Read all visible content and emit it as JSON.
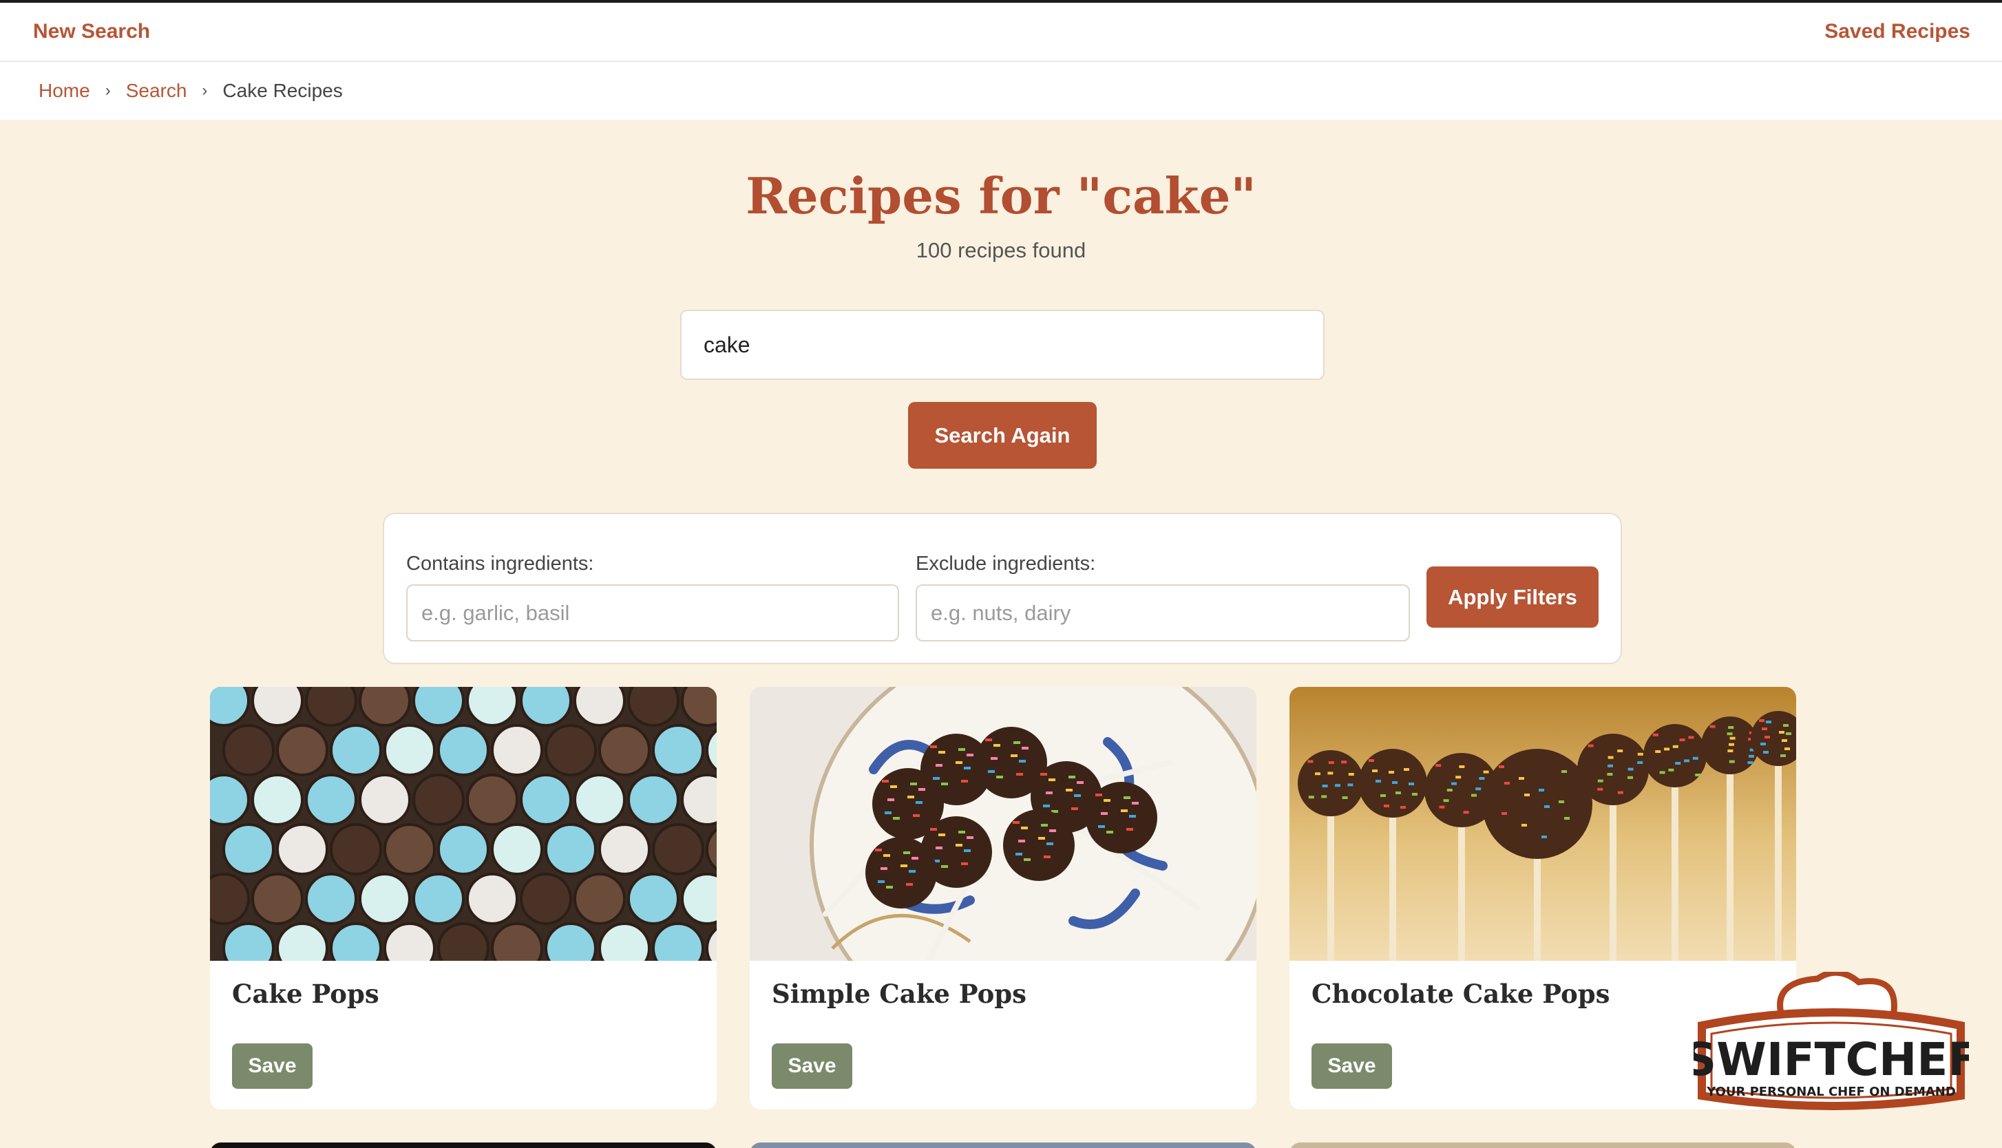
{
  "topbar": {
    "new_search": "New Search",
    "saved_recipes": "Saved Recipes"
  },
  "breadcrumb": {
    "home": "Home",
    "search": "Search",
    "current": "Cake Recipes",
    "separator": "›"
  },
  "header": {
    "title": "Recipes for \"cake\"",
    "count": "100 recipes found"
  },
  "search": {
    "value": "cake",
    "button": "Search Again"
  },
  "filters": {
    "contains_label": "Contains ingredients:",
    "contains_placeholder": "e.g. garlic, basil",
    "exclude_label": "Exclude ingredients:",
    "exclude_placeholder": "e.g. nuts, dairy",
    "apply": "Apply Filters"
  },
  "recipes": [
    {
      "title": "Cake Pops",
      "save": "Save"
    },
    {
      "title": "Simple Cake Pops",
      "save": "Save"
    },
    {
      "title": "Chocolate Cake Pops",
      "save": "Save"
    }
  ],
  "logo": {
    "name": "SWIFTCHEF",
    "tagline": "YOUR PERSONAL CHEF ON DEMAND"
  },
  "colors": {
    "accent": "#b75535",
    "background": "#faf1e0",
    "save": "#7b8a6b"
  }
}
